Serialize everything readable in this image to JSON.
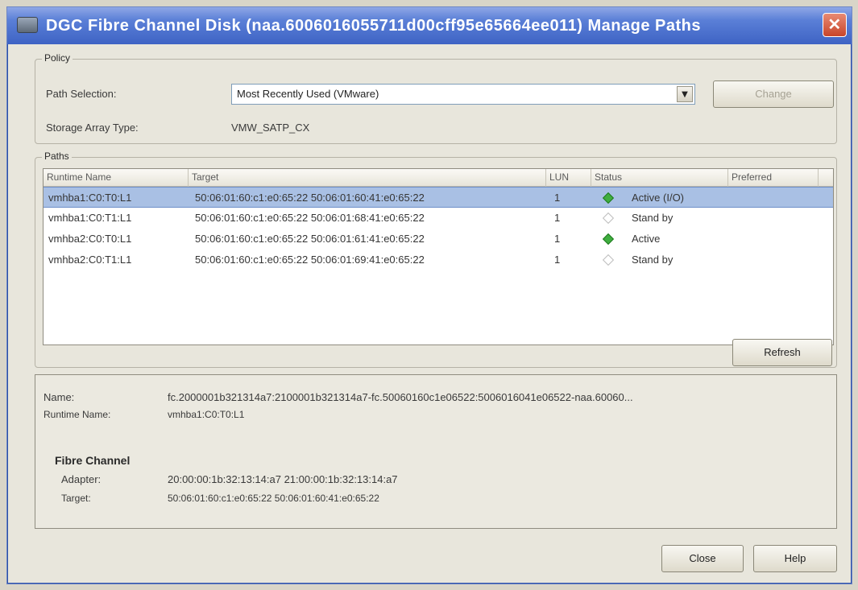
{
  "window": {
    "title": "DGC Fibre Channel Disk (naa.6006016055711d00cff95e65664ee011) Manage Paths",
    "close_glyph": "✕"
  },
  "policy": {
    "legend": "Policy",
    "path_selection_label": "Path Selection:",
    "path_selection_value": "Most Recently Used (VMware)",
    "change_button": "Change",
    "storage_array_type_label": "Storage Array Type:",
    "storage_array_type_value": "VMW_SATP_CX"
  },
  "paths": {
    "legend": "Paths",
    "columns": [
      "Runtime Name",
      "Target",
      "LUN",
      "Status",
      "Preferred"
    ],
    "rows": [
      {
        "runtime_name": "vmhba1:C0:T0:L1",
        "target": "50:06:01:60:c1:e0:65:22 50:06:01:60:41:e0:65:22",
        "lun": "1",
        "status": "Active (I/O)",
        "status_kind": "active",
        "preferred": ""
      },
      {
        "runtime_name": "vmhba1:C0:T1:L1",
        "target": "50:06:01:60:c1:e0:65:22 50:06:01:68:41:e0:65:22",
        "lun": "1",
        "status": "Stand by",
        "status_kind": "standby",
        "preferred": ""
      },
      {
        "runtime_name": "vmhba2:C0:T0:L1",
        "target": "50:06:01:60:c1:e0:65:22 50:06:01:61:41:e0:65:22",
        "lun": "1",
        "status": "Active",
        "status_kind": "active",
        "preferred": ""
      },
      {
        "runtime_name": "vmhba2:C0:T1:L1",
        "target": "50:06:01:60:c1:e0:65:22 50:06:01:69:41:e0:65:22",
        "lun": "1",
        "status": "Stand by",
        "status_kind": "standby",
        "preferred": ""
      }
    ],
    "refresh_button": "Refresh"
  },
  "details": {
    "name_label": "Name:",
    "name_value": "fc.2000001b321314a7:2100001b321314a7-fc.50060160c1e06522:5006016041e06522-naa.60060...",
    "runtime_name_label": "Runtime Name:",
    "runtime_name_value": "vmhba1:C0:T0:L1",
    "section_title": "Fibre Channel",
    "adapter_label": "Adapter:",
    "adapter_value": "20:00:00:1b:32:13:14:a7 21:00:00:1b:32:13:14:a7",
    "target_label": "Target:",
    "target_value": "50:06:01:60:c1:e0:65:22 50:06:01:60:41:e0:65:22"
  },
  "footer": {
    "close_button": "Close",
    "help_button": "Help"
  }
}
